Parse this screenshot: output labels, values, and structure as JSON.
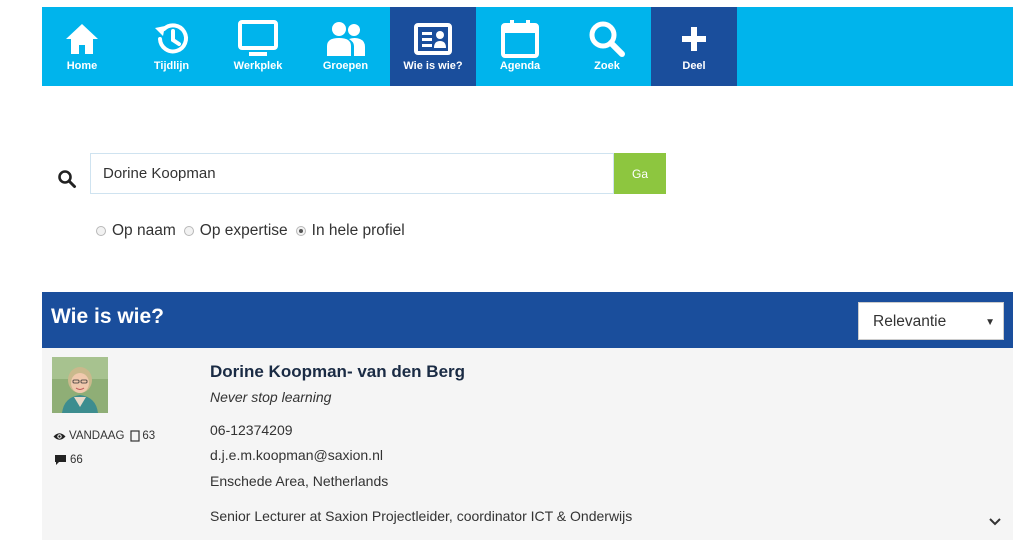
{
  "nav": {
    "items": [
      {
        "label": "Home",
        "icon": "home-icon"
      },
      {
        "label": "Tijdlijn",
        "icon": "history-icon"
      },
      {
        "label": "Werkplek",
        "icon": "monitor-icon"
      },
      {
        "label": "Groepen",
        "icon": "people-icon"
      },
      {
        "label": "Wie is wie?",
        "icon": "id-card-icon",
        "active": true
      },
      {
        "label": "Agenda",
        "icon": "calendar-icon"
      },
      {
        "label": "Zoek",
        "icon": "search-icon"
      },
      {
        "label": "Deel",
        "icon": "plus-icon"
      }
    ]
  },
  "search": {
    "value": "Dorine Koopman",
    "button": "Ga",
    "options": [
      "Op naam",
      "Op expertise",
      "In hele profiel"
    ],
    "selected": "In hele profiel"
  },
  "results": {
    "title": "Wie is wie?",
    "sort": "Relevantie"
  },
  "person": {
    "name": "Dorine Koopman- van den Berg",
    "tagline": "Never stop learning",
    "phone": "06-12374209",
    "email": "d.j.e.m.koopman@saxion.nl",
    "location": "Enschede Area, Netherlands",
    "role": "Senior Lecturer at Saxion Projectleider, coordinator ICT & Onderwijs",
    "last_seen": "VANDAAG",
    "doc_count": "63",
    "comment_count": "66"
  },
  "colors": {
    "nav_bg": "#00b4ec",
    "nav_active": "#1a4e9c",
    "header_bg": "#1a4e9c",
    "go_button": "#8dc63f"
  }
}
